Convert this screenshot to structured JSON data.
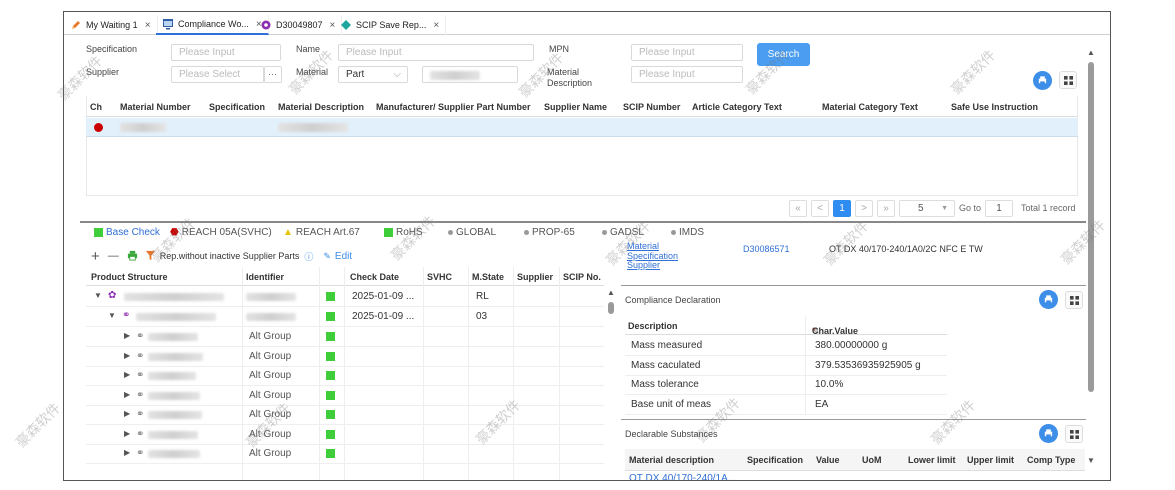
{
  "tabs": [
    {
      "label": "My Waiting 1",
      "icon": "pencil-icon"
    },
    {
      "label": "Compliance Wo...",
      "icon": "window-icon",
      "active": true
    },
    {
      "label": "D30049807",
      "icon": "gear-icon"
    },
    {
      "label": "SCIP Save Rep...",
      "icon": "diamond-icon"
    }
  ],
  "search": {
    "specification_label": "Specification",
    "specification_placeholder": "Please Input",
    "name_label": "Name",
    "name_placeholder": "Please Input",
    "mpn_label": "MPN",
    "mpn_placeholder": "Please Input",
    "supplier_label": "Supplier",
    "supplier_placeholder": "Please Select",
    "supplier_more": "···",
    "material_label": "Material",
    "material_type_value": "Part",
    "material_description_label": "Material Description",
    "material_description_placeholder": "Please Input",
    "search_button": "Search"
  },
  "top_table": {
    "columns": [
      "Ch",
      "Material Number",
      "Specification",
      "Material Description",
      "Manufacturer/ Supplier Part Number",
      "Supplier Name",
      "SCIP Number",
      "Article Category Text",
      "Material Category Text",
      "Safe Use Instruction"
    ]
  },
  "pagination": {
    "prev_first": "«",
    "prev": "<",
    "current_page": "1",
    "next": ">",
    "next_last": "»",
    "page_size": "5",
    "goto_label": "Go to",
    "goto_value": "1",
    "total": "Total 1 record"
  },
  "bottom_tabs": [
    "Base Check",
    "REACH 05A(SVHC)",
    "REACH Art.67",
    "RoHS",
    "GLOBAL",
    "PROP-65",
    "GADSL",
    "IMDS"
  ],
  "toolbar": {
    "rep_label": "Rep.without inactive Supplier Parts",
    "edit_label": "Edit",
    "plus": "+",
    "minus": "—"
  },
  "structure_table": {
    "columns": [
      "Product Structure",
      "Identifier",
      "Check Date",
      "SVHC",
      "M.State",
      "Supplier",
      "SCIP No."
    ],
    "rows": [
      {
        "identifier": "",
        "check_date": "2025-01-09 ...",
        "mstate": "RL",
        "level": 0
      },
      {
        "identifier": "",
        "check_date": "2025-01-09 ...",
        "mstate": "03",
        "level": 1
      },
      {
        "identifier": "Alt Group",
        "check_date": "",
        "mstate": "",
        "level": 2
      },
      {
        "identifier": "Alt Group",
        "check_date": "",
        "mstate": "",
        "level": 2
      },
      {
        "identifier": "Alt Group",
        "check_date": "",
        "mstate": "",
        "level": 2
      },
      {
        "identifier": "Alt Group",
        "check_date": "",
        "mstate": "",
        "level": 2
      },
      {
        "identifier": "Alt Group",
        "check_date": "",
        "mstate": "",
        "level": 2
      },
      {
        "identifier": "Alt Group",
        "check_date": "",
        "mstate": "",
        "level": 2
      },
      {
        "identifier": "Alt Group",
        "check_date": "",
        "mstate": "",
        "level": 2
      }
    ]
  },
  "detail": {
    "links": [
      "Material",
      "Specification",
      "Supplier"
    ],
    "material_no": "D30086571",
    "material_desc": "OT DX 40/170-240/1A0/2C NFC E TW",
    "compliance_title": "Compliance Declaration",
    "compliance_columns": [
      "Description",
      "Char.Value"
    ],
    "compliance_rows": [
      {
        "description": "Mass measured",
        "value": "380.00000000 g"
      },
      {
        "description": "Mass caculated",
        "value": "379.53536935925905 g"
      },
      {
        "description": "Mass tolerance",
        "value": "10.0%"
      },
      {
        "description": "Base unit of meas",
        "value": "EA"
      }
    ],
    "declarable_title": "Declarable Substances",
    "declarable_columns": [
      "Material description",
      "Specification",
      "Value",
      "UoM",
      "Lower limit",
      "Upper limit",
      "Comp Type"
    ],
    "declarable_first": "OT DX 40/170-240/1A..."
  },
  "watermark": "豪森软件",
  "colors": {
    "accent": "#2f8cf0",
    "status_red": "#cc0000",
    "status_green": "#3fce3a"
  }
}
